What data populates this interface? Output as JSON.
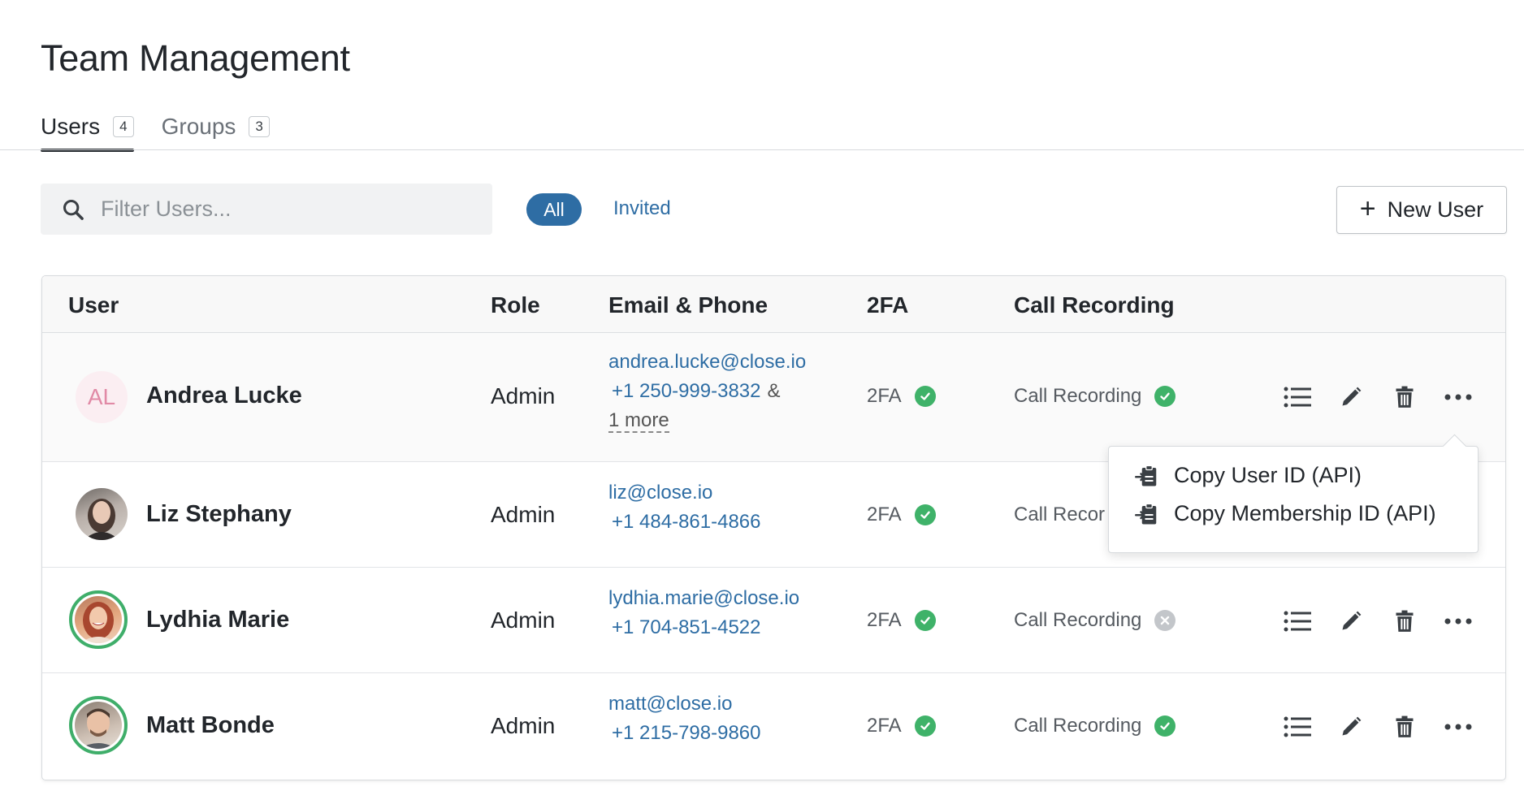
{
  "page": {
    "title": "Team Management"
  },
  "tabs": [
    {
      "label": "Users",
      "count": "4"
    },
    {
      "label": "Groups",
      "count": "3"
    }
  ],
  "toolbar": {
    "search_placeholder": "Filter Users...",
    "filter_all": "All",
    "filter_invited": "Invited",
    "new_user": "New User"
  },
  "table": {
    "headers": {
      "user": "User",
      "role": "Role",
      "email_phone": "Email & Phone",
      "twofa": "2FA",
      "call_recording": "Call Recording"
    },
    "rows": [
      {
        "name": "Andrea Lucke",
        "initials": "AL",
        "role": "Admin",
        "email": "andrea.lucke@close.io",
        "phone": "+1 250-999-3832",
        "amp": "&",
        "more": "1 more",
        "twofa": "2FA",
        "twofa_status": "enabled",
        "call_recording": "Call Recording",
        "call_recording_status": "enabled"
      },
      {
        "name": "Liz Stephany",
        "role": "Admin",
        "email": "liz@close.io",
        "phone": "+1 484-861-4866",
        "twofa": "2FA",
        "twofa_status": "enabled",
        "call_recording": "Call Recor",
        "call_recording_status": "hidden-by-menu"
      },
      {
        "name": "Lydhia Marie",
        "role": "Admin",
        "email": "lydhia.marie@close.io",
        "phone": "+1 704-851-4522",
        "twofa": "2FA",
        "twofa_status": "enabled",
        "call_recording": "Call Recording",
        "call_recording_status": "disabled"
      },
      {
        "name": "Matt Bonde",
        "role": "Admin",
        "email": "matt@close.io",
        "phone": "+1 215-798-9860",
        "twofa": "2FA",
        "twofa_status": "enabled",
        "call_recording": "Call Recording",
        "call_recording_status": "enabled"
      }
    ]
  },
  "menu": {
    "items": [
      {
        "label": "Copy User ID (API)",
        "icon": "clipboard-icon"
      },
      {
        "label": "Copy Membership ID (API)",
        "icon": "clipboard-icon"
      }
    ]
  },
  "colors": {
    "accent": "#2e6da4",
    "success": "#3fb269",
    "disabled": "#c3c6ca",
    "avatar_ring": "#3fae6a"
  }
}
